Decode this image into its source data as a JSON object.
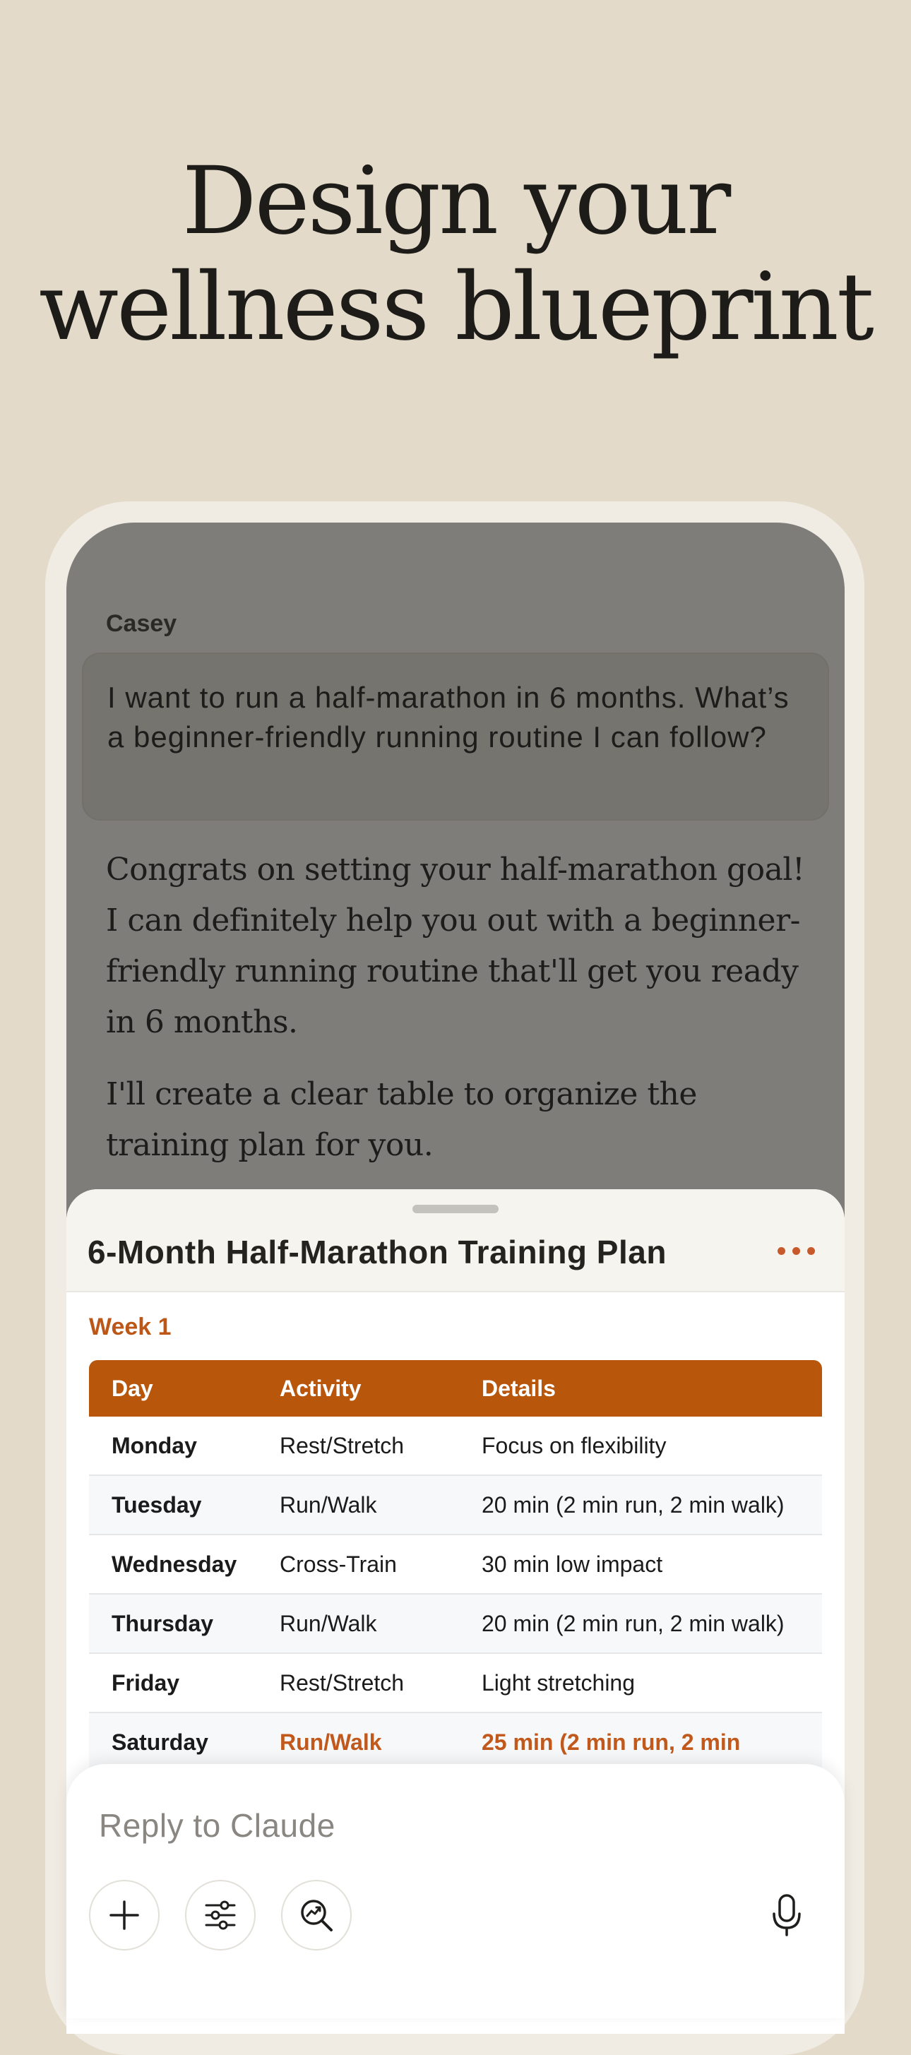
{
  "headline": {
    "line1": "Design your",
    "line2": "wellness blueprint"
  },
  "chat": {
    "sender_name": "Casey",
    "user_message": "I want to run a half-marathon in 6 months. What’s a beginner-friendly running routine I can follow?",
    "assistant_paragraphs": [
      "Congrats on setting your half-marathon goal! I can definitely help you out with a beginner-friendly running routine that'll get you ready in 6 months.",
      "I'll create a clear table to organize the training plan for you."
    ]
  },
  "artifact": {
    "title": "6-Month Half-Marathon Training Plan",
    "week_label": "Week 1",
    "columns": [
      "Day",
      "Activity",
      "Details"
    ],
    "rows": [
      {
        "day": "Monday",
        "activity": "Rest/Stretch",
        "details": "Focus on flexibility"
      },
      {
        "day": "Tuesday",
        "activity": "Run/Walk",
        "details": "20 min (2 min run, 2 min walk)"
      },
      {
        "day": "Wednesday",
        "activity": "Cross-Train",
        "details": "30 min low impact"
      },
      {
        "day": "Thursday",
        "activity": "Run/Walk",
        "details": "20 min (2 min run, 2 min walk)"
      },
      {
        "day": "Friday",
        "activity": "Rest/Stretch",
        "details": "Light stretching"
      },
      {
        "day": "Saturday",
        "activity": "Run/Walk",
        "details": "25 min (2 min run, 2 min"
      }
    ],
    "accent_color": "#b8560c"
  },
  "composer": {
    "placeholder": "Reply to Claude",
    "buttons": [
      "plus-icon",
      "sliders-icon",
      "research-icon",
      "microphone-icon"
    ]
  },
  "colors": {
    "background": "#e3dac9",
    "overlay": "#7e7d7a",
    "accent": "#c0591b"
  }
}
